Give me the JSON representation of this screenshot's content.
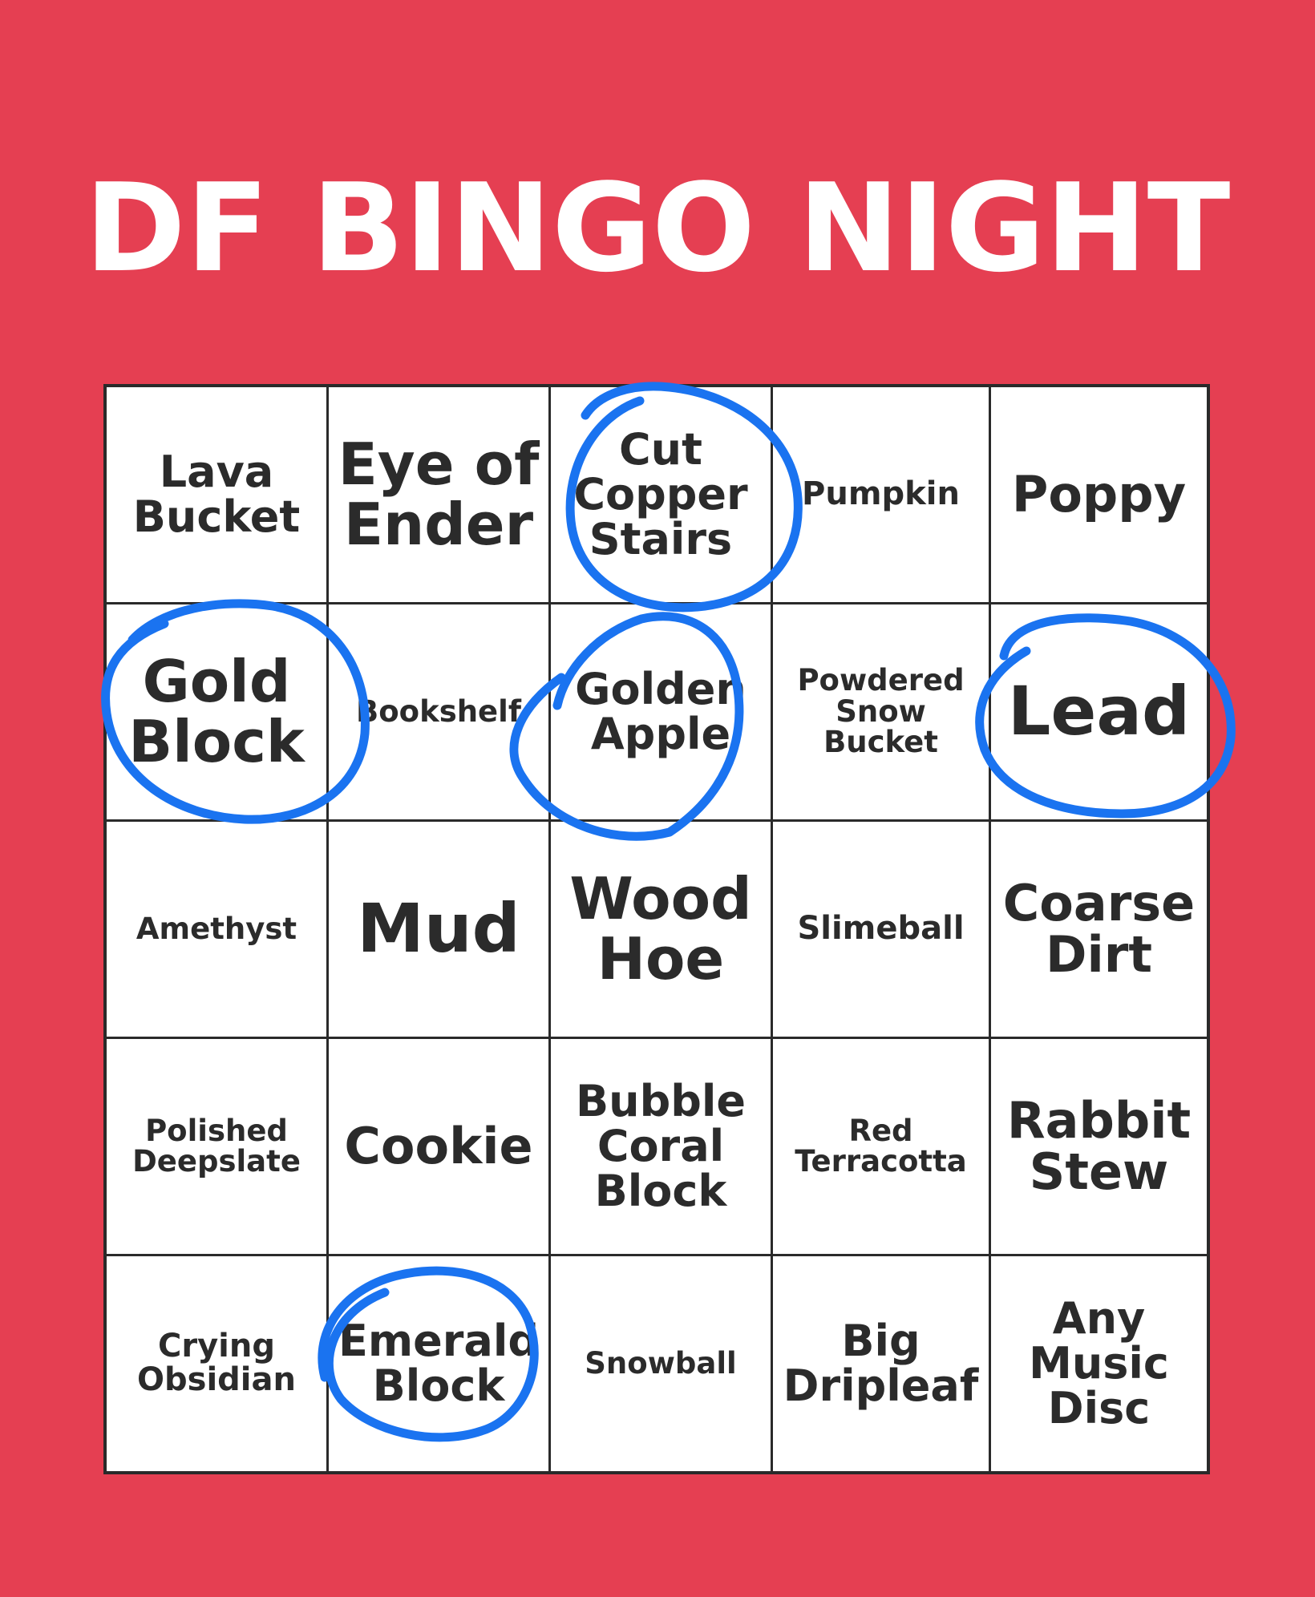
{
  "title": "DF BINGO NIGHT",
  "board": {
    "rows": [
      [
        {
          "label": "Lava\nBucket",
          "marked": false
        },
        {
          "label": "Eye of\nEnder",
          "marked": false
        },
        {
          "label": "Cut\nCopper\nStairs",
          "marked": true
        },
        {
          "label": "Pumpkin",
          "marked": false
        },
        {
          "label": "Poppy",
          "marked": false
        }
      ],
      [
        {
          "label": "Gold\nBlock",
          "marked": true
        },
        {
          "label": "Bookshelf",
          "marked": false
        },
        {
          "label": "Golden\nApple",
          "marked": true
        },
        {
          "label": "Powdered\nSnow\nBucket",
          "marked": false
        },
        {
          "label": "Lead",
          "marked": true
        }
      ],
      [
        {
          "label": "Amethyst",
          "marked": false
        },
        {
          "label": "Mud",
          "marked": false
        },
        {
          "label": "Wood\nHoe",
          "marked": false
        },
        {
          "label": "Slimeball",
          "marked": false
        },
        {
          "label": "Coarse\nDirt",
          "marked": false
        }
      ],
      [
        {
          "label": "Polished\nDeepslate",
          "marked": false
        },
        {
          "label": "Cookie",
          "marked": false
        },
        {
          "label": "Bubble\nCoral\nBlock",
          "marked": false
        },
        {
          "label": "Red\nTerracotta",
          "marked": false
        },
        {
          "label": "Rabbit\nStew",
          "marked": false
        }
      ],
      [
        {
          "label": "Crying\nObsidian",
          "marked": false
        },
        {
          "label": "Emerald\nBlock",
          "marked": true
        },
        {
          "label": "Snowball",
          "marked": false
        },
        {
          "label": "Big\nDripleaf",
          "marked": false
        },
        {
          "label": "Any\nMusic\nDisc",
          "marked": false
        }
      ]
    ]
  },
  "colors": {
    "background": "#e53f52",
    "title": "#ffffff",
    "cell_text": "#2b2b2b",
    "grid_lines": "#2a2a2a",
    "circle_marker": "#1a73f0"
  }
}
